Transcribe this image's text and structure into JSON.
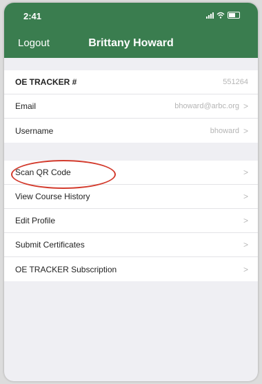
{
  "status_bar": {
    "time": "2:41"
  },
  "header": {
    "logout_label": "Logout",
    "title": "Brittany Howard"
  },
  "account": {
    "rows": [
      {
        "label": "OE TRACKER #",
        "value": "551264"
      },
      {
        "label": "Email",
        "value": "bhoward@arbc.org"
      },
      {
        "label": "Username",
        "value": "bhoward"
      }
    ]
  },
  "menu": {
    "items": [
      {
        "label": "Scan QR Code"
      },
      {
        "label": "View Course History"
      },
      {
        "label": "Edit Profile"
      },
      {
        "label": "Submit Certificates"
      },
      {
        "label": "OE TRACKER Subscription"
      }
    ]
  },
  "colors": {
    "header": "#3a7d4f",
    "highlight": "#d33a2c"
  },
  "icons": {
    "chevron": "chevron-right-icon"
  }
}
